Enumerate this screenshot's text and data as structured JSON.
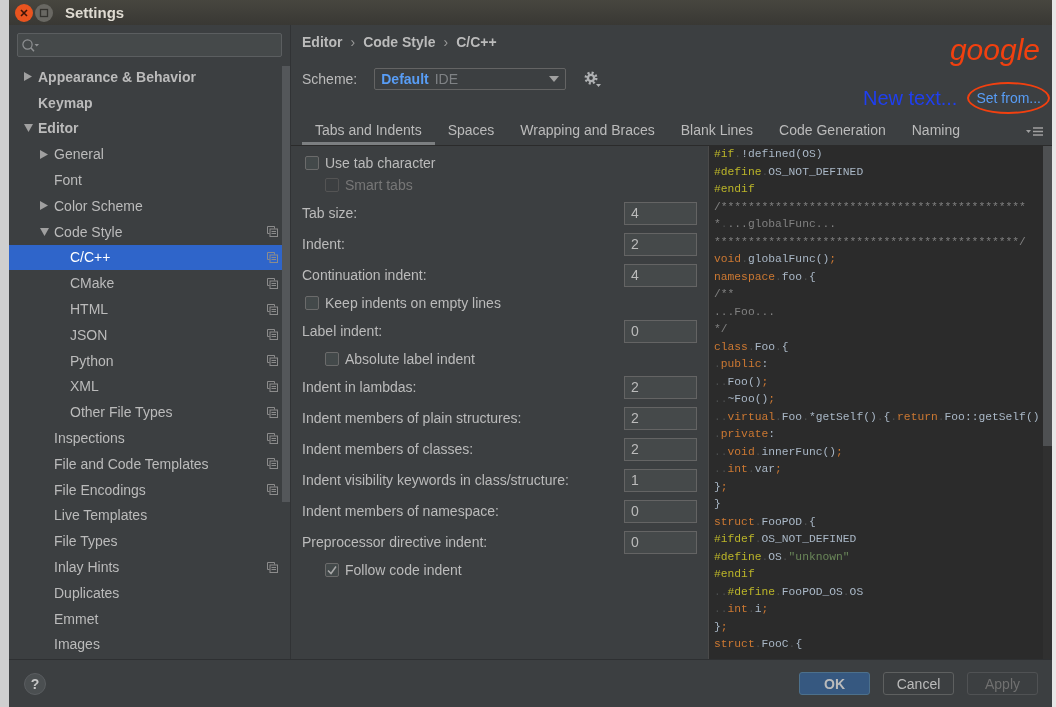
{
  "window": {
    "title": "Settings"
  },
  "sidebar": {
    "tree": [
      {
        "label": "Appearance & Behavior",
        "expanded": false,
        "selected": false,
        "icon": false
      },
      {
        "label": "Keymap",
        "selected": false,
        "icon": false
      },
      {
        "label": "Editor",
        "expanded": true,
        "selected": false,
        "icon": false,
        "children": [
          {
            "label": "General",
            "expanded": false,
            "selected": false,
            "icon": false
          },
          {
            "label": "Font",
            "selected": false,
            "icon": false
          },
          {
            "label": "Color Scheme",
            "expanded": false,
            "selected": false,
            "icon": false
          },
          {
            "label": "Code Style",
            "expanded": true,
            "selected": false,
            "icon": true,
            "children": [
              {
                "label": "C/C++",
                "selected": true,
                "icon": true
              },
              {
                "label": "CMake",
                "selected": false,
                "icon": true
              },
              {
                "label": "HTML",
                "selected": false,
                "icon": true
              },
              {
                "label": "JSON",
                "selected": false,
                "icon": true
              },
              {
                "label": "Python",
                "selected": false,
                "icon": true
              },
              {
                "label": "XML",
                "selected": false,
                "icon": true
              },
              {
                "label": "Other File Types",
                "selected": false,
                "icon": true
              }
            ]
          },
          {
            "label": "Inspections",
            "selected": false,
            "icon": true
          },
          {
            "label": "File and Code Templates",
            "selected": false,
            "icon": true
          },
          {
            "label": "File Encodings",
            "selected": false,
            "icon": true
          },
          {
            "label": "Live Templates",
            "selected": false,
            "icon": false
          },
          {
            "label": "File Types",
            "selected": false,
            "icon": false
          },
          {
            "label": "Inlay Hints",
            "selected": false,
            "icon": true
          },
          {
            "label": "Duplicates",
            "selected": false,
            "icon": false
          },
          {
            "label": "Emmet",
            "selected": false,
            "icon": false
          },
          {
            "label": "Images",
            "selected": false,
            "icon": false
          }
        ]
      }
    ]
  },
  "header": {
    "breadcrumb": [
      {
        "kind": "crumb",
        "text": "Editor"
      },
      {
        "kind": "separator",
        "text": "›"
      },
      {
        "kind": "crumb",
        "text": "Code Style"
      },
      {
        "kind": "separator",
        "text": "›"
      },
      {
        "kind": "crumb",
        "text": "C/C++"
      }
    ],
    "scheme": {
      "label": "Scheme:",
      "name": "Default",
      "scope": "IDE"
    },
    "handwritten_note": "google",
    "overlay_text": "New text...",
    "link": {
      "text": "Set from...",
      "circled": true
    }
  },
  "tabs": [
    {
      "label": "Tabs and Indents",
      "selected": true
    },
    {
      "label": "Spaces",
      "selected": false
    },
    {
      "label": "Wrapping and Braces",
      "selected": false
    },
    {
      "label": "Blank Lines",
      "selected": false
    },
    {
      "label": "Code Generation",
      "selected": false
    },
    {
      "label": "Naming",
      "selected": false
    }
  ],
  "options": [
    {
      "kind": "checkbox",
      "label": "Use tab character",
      "checked": false,
      "disabled": false,
      "children": [
        {
          "kind": "checkbox",
          "label": "Smart tabs",
          "checked": false,
          "disabled": true
        }
      ]
    },
    {
      "kind": "number",
      "label": "Tab size:",
      "value": "4"
    },
    {
      "kind": "number",
      "label": "Indent:",
      "value": "2"
    },
    {
      "kind": "number",
      "label": "Continuation indent:",
      "value": "4"
    },
    {
      "kind": "checkbox",
      "label": "Keep indents on empty lines",
      "checked": false,
      "disabled": false
    },
    {
      "kind": "number",
      "label": "Label indent:",
      "value": "0",
      "children": [
        {
          "kind": "checkbox",
          "label": "Absolute label indent",
          "checked": false,
          "disabled": false
        }
      ]
    },
    {
      "kind": "number",
      "label": "Indent in lambdas:",
      "value": "2"
    },
    {
      "kind": "number",
      "label": "Indent members of plain structures:",
      "value": "2"
    },
    {
      "kind": "number",
      "label": "Indent members of classes:",
      "value": "2"
    },
    {
      "kind": "number",
      "label": "Indent visibility keywords in class/structure:",
      "value": "1"
    },
    {
      "kind": "number",
      "label": "Indent members of namespace:",
      "value": "0"
    },
    {
      "kind": "number",
      "label": "Preprocessor directive indent:",
      "value": "0",
      "children": [
        {
          "kind": "checkbox",
          "label": "Follow code indent",
          "checked": true,
          "disabled": false
        }
      ]
    }
  ],
  "preview": {
    "lines": [
      {
        "tokens": [
          {
            "kind": "directive",
            "text": "#if"
          },
          {
            "kind": "space",
            "text": "."
          },
          {
            "kind": "plain",
            "text": "!defined(OS)"
          }
        ]
      },
      {
        "tokens": [
          {
            "kind": "directive",
            "text": "#define"
          },
          {
            "kind": "space",
            "text": "."
          },
          {
            "kind": "plain",
            "text": "OS_NOT_DEFINED"
          }
        ]
      },
      {
        "tokens": [
          {
            "kind": "directive",
            "text": "#endif"
          }
        ]
      },
      {
        "tokens": [
          {
            "kind": "comment",
            "text": "/*********************************************"
          }
        ]
      },
      {
        "tokens": [
          {
            "kind": "comment",
            "text": "*"
          },
          {
            "kind": "space",
            "text": "."
          },
          {
            "kind": "comment",
            "text": "...globalFunc..."
          }
        ]
      },
      {
        "tokens": [
          {
            "kind": "comment",
            "text": "*********************************************/"
          }
        ]
      },
      {
        "tokens": [
          {
            "kind": "keyword",
            "text": "void"
          },
          {
            "kind": "space",
            "text": "."
          },
          {
            "kind": "plain",
            "text": "globalFunc()"
          },
          {
            "kind": "punct",
            "text": ";"
          }
        ]
      },
      {
        "tokens": [
          {
            "kind": "keyword",
            "text": "namespace"
          },
          {
            "kind": "space",
            "text": "."
          },
          {
            "kind": "plain",
            "text": "foo"
          },
          {
            "kind": "space",
            "text": "."
          },
          {
            "kind": "plain",
            "text": "{"
          }
        ]
      },
      {
        "tokens": [
          {
            "kind": "comment",
            "text": "/**"
          }
        ]
      },
      {
        "tokens": [
          {
            "kind": "comment",
            "text": "...Foo..."
          }
        ]
      },
      {
        "tokens": [
          {
            "kind": "comment",
            "text": "*/"
          }
        ]
      },
      {
        "tokens": [
          {
            "kind": "keyword",
            "text": "class"
          },
          {
            "kind": "space",
            "text": "."
          },
          {
            "kind": "plain",
            "text": "Foo"
          },
          {
            "kind": "space",
            "text": "."
          },
          {
            "kind": "plain",
            "text": "{"
          }
        ]
      },
      {
        "tokens": [
          {
            "kind": "space",
            "text": "."
          },
          {
            "kind": "keyword",
            "text": "public"
          },
          {
            "kind": "plain",
            "text": ":"
          }
        ]
      },
      {
        "tokens": [
          {
            "kind": "space",
            "text": ".."
          },
          {
            "kind": "plain",
            "text": "Foo()"
          },
          {
            "kind": "punct",
            "text": ";"
          }
        ]
      },
      {
        "tokens": [
          {
            "kind": "space",
            "text": ".."
          },
          {
            "kind": "plain",
            "text": "~Foo()"
          },
          {
            "kind": "punct",
            "text": ";"
          }
        ]
      },
      {
        "tokens": [
          {
            "kind": "space",
            "text": ".."
          },
          {
            "kind": "keyword",
            "text": "virtual"
          },
          {
            "kind": "space",
            "text": "."
          },
          {
            "kind": "plain",
            "text": "Foo"
          },
          {
            "kind": "space",
            "text": "."
          },
          {
            "kind": "plain",
            "text": "*getSelf()"
          },
          {
            "kind": "space",
            "text": "."
          },
          {
            "kind": "plain",
            "text": "{"
          },
          {
            "kind": "space",
            "text": "."
          },
          {
            "kind": "keyword",
            "text": "return"
          },
          {
            "kind": "space",
            "text": "."
          },
          {
            "kind": "plain",
            "text": "Foo::getSelf()"
          }
        ]
      },
      {
        "tokens": [
          {
            "kind": "space",
            "text": "."
          },
          {
            "kind": "keyword",
            "text": "private"
          },
          {
            "kind": "plain",
            "text": ":"
          }
        ]
      },
      {
        "tokens": [
          {
            "kind": "space",
            "text": ".."
          },
          {
            "kind": "keyword",
            "text": "void"
          },
          {
            "kind": "space",
            "text": "."
          },
          {
            "kind": "plain",
            "text": "innerFunc()"
          },
          {
            "kind": "punct",
            "text": ";"
          }
        ]
      },
      {
        "tokens": [
          {
            "kind": "space",
            "text": ".."
          },
          {
            "kind": "keyword",
            "text": "int"
          },
          {
            "kind": "space",
            "text": "."
          },
          {
            "kind": "plain",
            "text": "var"
          },
          {
            "kind": "punct",
            "text": ";"
          }
        ]
      },
      {
        "tokens": [
          {
            "kind": "plain",
            "text": "}"
          },
          {
            "kind": "punct",
            "text": ";"
          }
        ]
      },
      {
        "tokens": [
          {
            "kind": "plain",
            "text": "}"
          }
        ]
      },
      {
        "tokens": [
          {
            "kind": "keyword",
            "text": "struct"
          },
          {
            "kind": "space",
            "text": "."
          },
          {
            "kind": "plain",
            "text": "FooPOD"
          },
          {
            "kind": "space",
            "text": "."
          },
          {
            "kind": "plain",
            "text": "{"
          }
        ]
      },
      {
        "tokens": [
          {
            "kind": "directive",
            "text": "#ifdef"
          },
          {
            "kind": "space",
            "text": "."
          },
          {
            "kind": "plain",
            "text": "OS_NOT_DEFINED"
          }
        ]
      },
      {
        "tokens": [
          {
            "kind": "directive",
            "text": "#define"
          },
          {
            "kind": "space",
            "text": "."
          },
          {
            "kind": "plain",
            "text": "OS"
          },
          {
            "kind": "space",
            "text": "."
          },
          {
            "kind": "string",
            "text": "\"unknown\""
          }
        ]
      },
      {
        "tokens": [
          {
            "kind": "directive",
            "text": "#endif"
          }
        ]
      },
      {
        "tokens": [
          {
            "kind": "space",
            "text": ".."
          },
          {
            "kind": "directive",
            "text": "#define"
          },
          {
            "kind": "space",
            "text": "."
          },
          {
            "kind": "plain",
            "text": "FooPOD_OS"
          },
          {
            "kind": "space",
            "text": "."
          },
          {
            "kind": "plain",
            "text": "OS"
          }
        ]
      },
      {
        "tokens": [
          {
            "kind": "space",
            "text": ".."
          },
          {
            "kind": "keyword",
            "text": "int"
          },
          {
            "kind": "space",
            "text": "."
          },
          {
            "kind": "plain",
            "text": "i"
          },
          {
            "kind": "punct",
            "text": ";"
          }
        ]
      },
      {
        "tokens": [
          {
            "kind": "plain",
            "text": "}"
          },
          {
            "kind": "punct",
            "text": ";"
          }
        ]
      },
      {
        "tokens": [
          {
            "kind": "keyword",
            "text": "struct"
          },
          {
            "kind": "space",
            "text": "."
          },
          {
            "kind": "plain",
            "text": "FooC"
          },
          {
            "kind": "space",
            "text": "."
          },
          {
            "kind": "plain",
            "text": "{"
          }
        ]
      }
    ]
  },
  "footer": {
    "help": "?",
    "buttons": [
      {
        "label": "OK",
        "default": true,
        "disabled": false
      },
      {
        "label": "Cancel",
        "default": false,
        "disabled": false
      },
      {
        "label": "Apply",
        "default": false,
        "disabled": true
      }
    ]
  }
}
